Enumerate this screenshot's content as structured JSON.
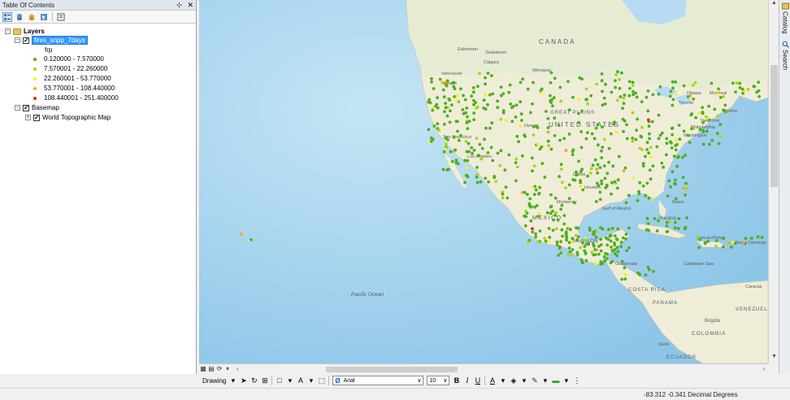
{
  "toc": {
    "title": "Table Of Contents",
    "pin_glyph": "⊹",
    "close_glyph": "✕",
    "tree": {
      "layers_label": "Layers",
      "fires_layer": "fires_snpp_7days",
      "field_label": "frp",
      "legend": [
        {
          "label": "0.120000 - 7.570000",
          "color": "#4caf1e"
        },
        {
          "label": "7.570001 - 22.260000",
          "color": "#a6d80f"
        },
        {
          "label": "22.260001 - 53.770000",
          "color": "#f4f023"
        },
        {
          "label": "53.770001 - 108.440000",
          "color": "#f5a623"
        },
        {
          "label": "108.440001 - 251.400000",
          "color": "#e8291c"
        }
      ],
      "basemap_label": "Basemap",
      "topo_label": "World Topographic Map"
    }
  },
  "right_tabs": {
    "catalog": "Catalog",
    "search": "Search"
  },
  "map": {
    "labels": {
      "canada": "CANADA",
      "edmonton": "Edmonton",
      "saskatoon": "Saskatoon",
      "calgary": "Calgary",
      "vancouver": "Vancouver",
      "seattle": "Seattle",
      "winnipeg": "Winnipeg",
      "ottawa": "Ottawa",
      "montreal": "Montreal",
      "toronto": "Toronto",
      "boston": "Boston",
      "new_york": "New York",
      "philadelphia": "Philadelphia",
      "washington": "Washington",
      "great_plains": "GREAT PLAINS",
      "united_states": "UNITED STATES",
      "denver": "Denver",
      "san_francisco": "San Francisco",
      "los_angeles": "Los Angeles",
      "dallas": "Dallas",
      "houston": "Houston",
      "monterrey": "Monterrey",
      "mexico": "MÉXICO",
      "gulf_of_mexico": "Gulf of Mexico",
      "miami": "Miami",
      "havana": "Havana",
      "mexico_city": "Mexico City",
      "guatemala": "Guatemala",
      "costa_rica": "COSTA RICA",
      "panama": "PANAMA",
      "caribbean_sea": "Caribbean Sea",
      "port_au_prince": "Port-au-Prince",
      "santo_domingo": "Santo Domingo",
      "caracas": "Caracas",
      "venezuela": "VENEZUELA",
      "bogota": "Bogota",
      "colombia": "COLOMBIA",
      "quito": "Quito",
      "ecuador": "ECUADOR",
      "pacific_ocean": "Pacific Ocean"
    }
  },
  "view_bar": {
    "left_arrow": "‹",
    "right_arrow": "›"
  },
  "draw_toolbar": {
    "drawing_label": "Drawing",
    "font_name": "Arial",
    "font_size": "10",
    "bold": "B",
    "italic": "I",
    "underline": "U"
  },
  "status": {
    "coordinates": "-83.312  -0.341 Decimal Degrees"
  }
}
